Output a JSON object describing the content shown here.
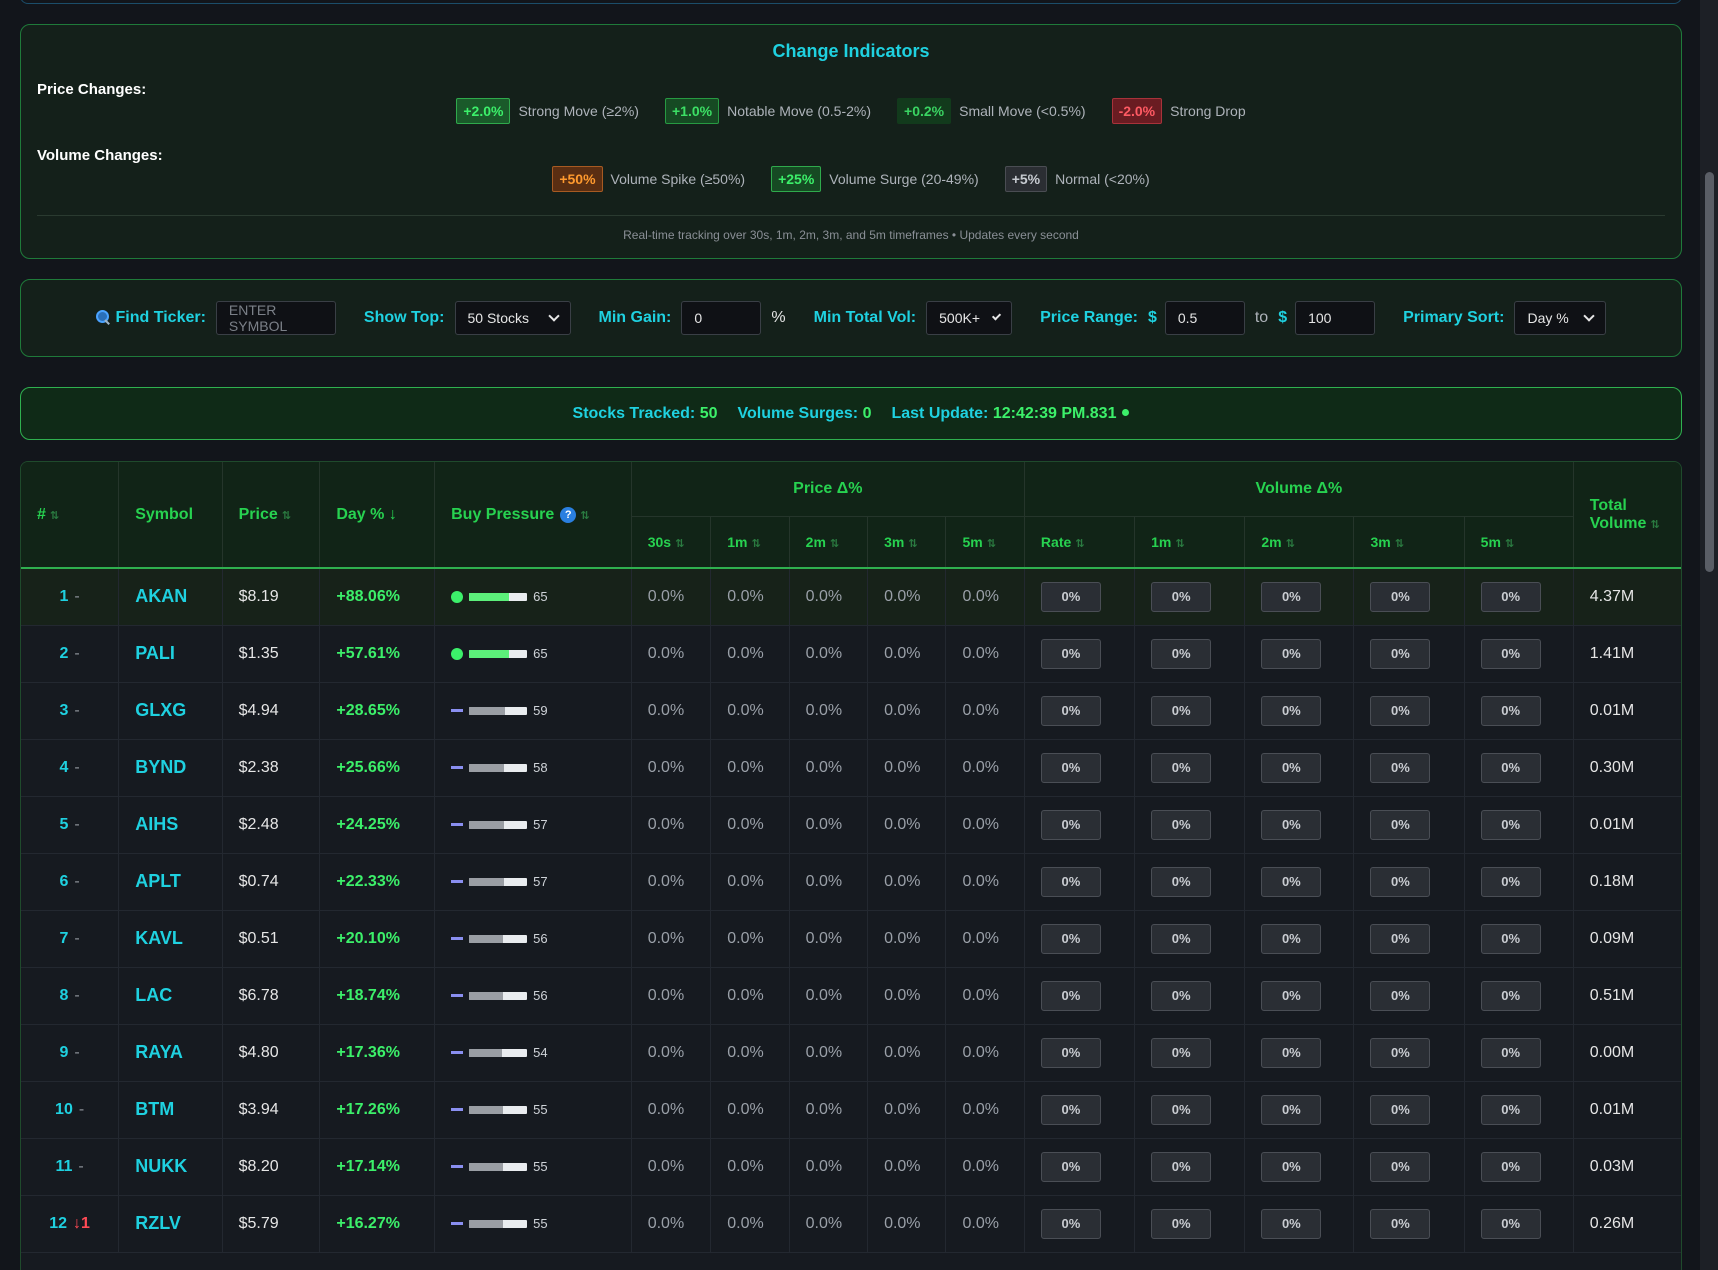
{
  "indicators": {
    "title": "Change Indicators",
    "price_label": "Price Changes:",
    "volume_label": "Volume Changes:",
    "price_items": [
      {
        "badge": "+2.0%",
        "desc": "Strong Move (≥2%)"
      },
      {
        "badge": "+1.0%",
        "desc": "Notable Move (0.5-2%)"
      },
      {
        "badge": "+0.2%",
        "desc": "Small Move (<0.5%)"
      },
      {
        "badge": "-2.0%",
        "desc": "Strong Drop"
      }
    ],
    "volume_items": [
      {
        "badge": "+50%",
        "desc": "Volume Spike (≥50%)"
      },
      {
        "badge": "+25%",
        "desc": "Volume Surge (20-49%)"
      },
      {
        "badge": "+5%",
        "desc": "Normal (<20%)"
      }
    ],
    "footer": "Real-time tracking over 30s, 1m, 2m, 3m, and 5m timeframes • Updates every second"
  },
  "controls": {
    "find_label": "Find Ticker:",
    "find_placeholder": "ENTER SYMBOL",
    "show_top_label": "Show Top:",
    "show_top_value": "50 Stocks",
    "min_gain_label": "Min Gain:",
    "min_gain_value": "0",
    "min_gain_unit": "%",
    "min_vol_label": "Min Total Vol:",
    "min_vol_value": "500K+",
    "price_range_label": "Price Range:",
    "currency": "$",
    "price_min": "0.5",
    "to_label": "to",
    "price_max": "100",
    "sort_label": "Primary Sort:",
    "sort_value": "Day %"
  },
  "stats": {
    "tracked_label": "Stocks Tracked:",
    "tracked_value": "50",
    "surges_label": "Volume Surges:",
    "surges_value": "0",
    "update_label": "Last Update:",
    "update_value": "12:42:39 PM.831"
  },
  "table": {
    "headers": {
      "rank": "#",
      "symbol": "Symbol",
      "price": "Price",
      "day": "Day % ↓",
      "buy_pressure": "Buy Pressure",
      "help": "?",
      "price_group": "Price Δ%",
      "volume_group": "Volume Δ%",
      "total_volume": "Total Volume",
      "p30s": "30s",
      "p1m": "1m",
      "p2m": "2m",
      "p3m": "3m",
      "p5m": "5m",
      "vrate": "Rate",
      "v1m": "1m",
      "v2m": "2m",
      "v3m": "3m",
      "v5m": "5m",
      "sort_icon": "⇅"
    },
    "rows": [
      {
        "rank": "1",
        "chg": "-",
        "symbol": "AKAN",
        "price": "$8.19",
        "day": "+88.06%",
        "bp": 65,
        "bp_label": "65",
        "bp_state": "high",
        "p": [
          "0.0%",
          "0.0%",
          "0.0%",
          "0.0%",
          "0.0%"
        ],
        "v": [
          "0%",
          "0%",
          "0%",
          "0%",
          "0%"
        ],
        "total": "4.37M"
      },
      {
        "rank": "2",
        "chg": "-",
        "symbol": "PALI",
        "price": "$1.35",
        "day": "+57.61%",
        "bp": 65,
        "bp_label": "65",
        "bp_state": "high",
        "p": [
          "0.0%",
          "0.0%",
          "0.0%",
          "0.0%",
          "0.0%"
        ],
        "v": [
          "0%",
          "0%",
          "0%",
          "0%",
          "0%"
        ],
        "total": "1.41M"
      },
      {
        "rank": "3",
        "chg": "-",
        "symbol": "GLXG",
        "price": "$4.94",
        "day": "+28.65%",
        "bp": 59,
        "bp_label": "59",
        "bp_state": "neutral",
        "p": [
          "0.0%",
          "0.0%",
          "0.0%",
          "0.0%",
          "0.0%"
        ],
        "v": [
          "0%",
          "0%",
          "0%",
          "0%",
          "0%"
        ],
        "total": "0.01M"
      },
      {
        "rank": "4",
        "chg": "-",
        "symbol": "BYND",
        "price": "$2.38",
        "day": "+25.66%",
        "bp": 58,
        "bp_label": "58",
        "bp_state": "neutral",
        "p": [
          "0.0%",
          "0.0%",
          "0.0%",
          "0.0%",
          "0.0%"
        ],
        "v": [
          "0%",
          "0%",
          "0%",
          "0%",
          "0%"
        ],
        "total": "0.30M"
      },
      {
        "rank": "5",
        "chg": "-",
        "symbol": "AIHS",
        "price": "$2.48",
        "day": "+24.25%",
        "bp": 57,
        "bp_label": "57",
        "bp_state": "neutral",
        "p": [
          "0.0%",
          "0.0%",
          "0.0%",
          "0.0%",
          "0.0%"
        ],
        "v": [
          "0%",
          "0%",
          "0%",
          "0%",
          "0%"
        ],
        "total": "0.01M"
      },
      {
        "rank": "6",
        "chg": "-",
        "symbol": "APLT",
        "price": "$0.74",
        "day": "+22.33%",
        "bp": 57,
        "bp_label": "57",
        "bp_state": "neutral",
        "p": [
          "0.0%",
          "0.0%",
          "0.0%",
          "0.0%",
          "0.0%"
        ],
        "v": [
          "0%",
          "0%",
          "0%",
          "0%",
          "0%"
        ],
        "total": "0.18M"
      },
      {
        "rank": "7",
        "chg": "-",
        "symbol": "KAVL",
        "price": "$0.51",
        "day": "+20.10%",
        "bp": 56,
        "bp_label": "56",
        "bp_state": "neutral",
        "p": [
          "0.0%",
          "0.0%",
          "0.0%",
          "0.0%",
          "0.0%"
        ],
        "v": [
          "0%",
          "0%",
          "0%",
          "0%",
          "0%"
        ],
        "total": "0.09M"
      },
      {
        "rank": "8",
        "chg": "-",
        "symbol": "LAC",
        "price": "$6.78",
        "day": "+18.74%",
        "bp": 56,
        "bp_label": "56",
        "bp_state": "neutral",
        "p": [
          "0.0%",
          "0.0%",
          "0.0%",
          "0.0%",
          "0.0%"
        ],
        "v": [
          "0%",
          "0%",
          "0%",
          "0%",
          "0%"
        ],
        "total": "0.51M"
      },
      {
        "rank": "9",
        "chg": "-",
        "symbol": "RAYA",
        "price": "$4.80",
        "day": "+17.36%",
        "bp": 54,
        "bp_label": "54",
        "bp_state": "neutral",
        "p": [
          "0.0%",
          "0.0%",
          "0.0%",
          "0.0%",
          "0.0%"
        ],
        "v": [
          "0%",
          "0%",
          "0%",
          "0%",
          "0%"
        ],
        "total": "0.00M"
      },
      {
        "rank": "10",
        "chg": "-",
        "symbol": "BTM",
        "price": "$3.94",
        "day": "+17.26%",
        "bp": 55,
        "bp_label": "55",
        "bp_state": "neutral",
        "p": [
          "0.0%",
          "0.0%",
          "0.0%",
          "0.0%",
          "0.0%"
        ],
        "v": [
          "0%",
          "0%",
          "0%",
          "0%",
          "0%"
        ],
        "total": "0.01M"
      },
      {
        "rank": "11",
        "chg": "-",
        "symbol": "NUKK",
        "price": "$8.20",
        "day": "+17.14%",
        "bp": 55,
        "bp_label": "55",
        "bp_state": "neutral",
        "p": [
          "0.0%",
          "0.0%",
          "0.0%",
          "0.0%",
          "0.0%"
        ],
        "v": [
          "0%",
          "0%",
          "0%",
          "0%",
          "0%"
        ],
        "total": "0.03M"
      },
      {
        "rank": "12",
        "chg": "↓1",
        "chg_dir": "down",
        "symbol": "RZLV",
        "price": "$5.79",
        "day": "+16.27%",
        "bp": 55,
        "bp_label": "55",
        "bp_state": "neutral",
        "p": [
          "0.0%",
          "0.0%",
          "0.0%",
          "0.0%",
          "0.0%"
        ],
        "v": [
          "0%",
          "0%",
          "0%",
          "0%",
          "0%"
        ],
        "total": "0.26M"
      }
    ]
  },
  "colors": {
    "accent_cyan": "#1fd1e0",
    "accent_green": "#3cf06a",
    "drop_red": "#ff5a63",
    "spike_orange": "#ff9a2e",
    "bp_high_fill": "#5cf07a",
    "bp_neutral_fill": "#9a9ea4"
  }
}
